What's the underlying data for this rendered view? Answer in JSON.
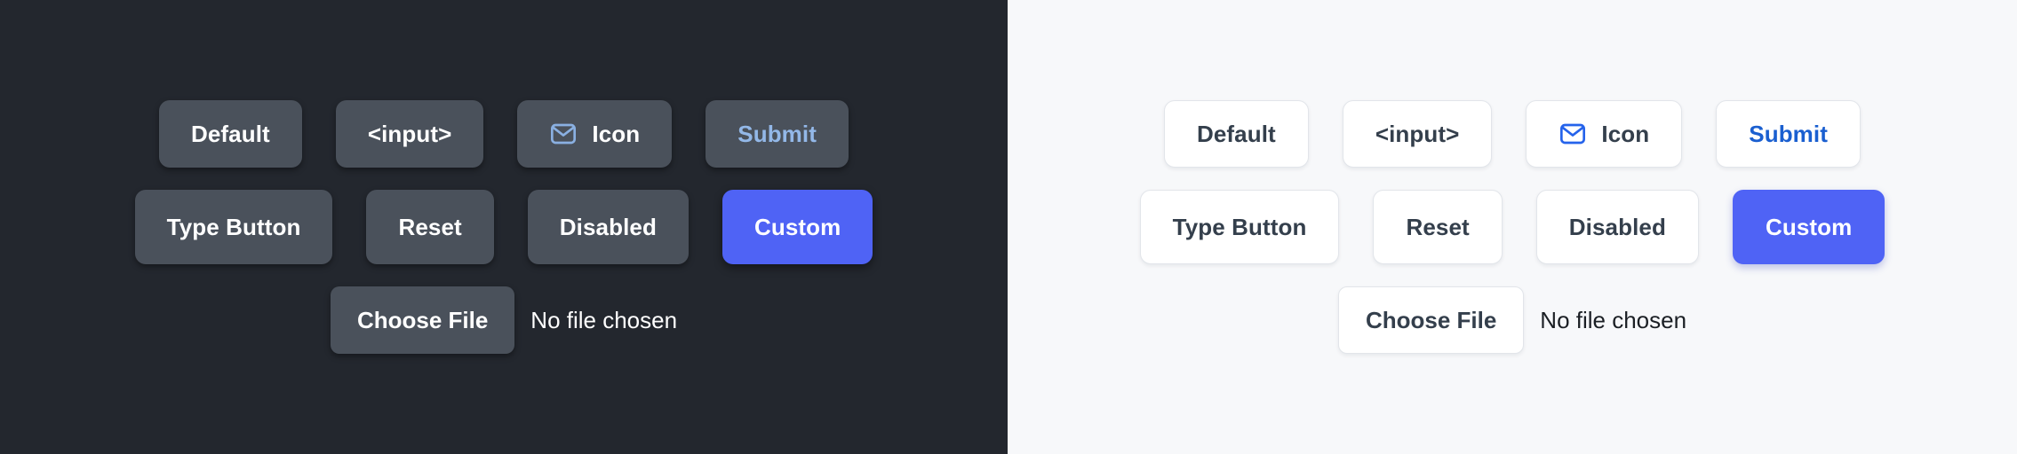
{
  "panels": [
    {
      "theme": "dark",
      "background": "#23272e",
      "surface": "#4a515b",
      "text": "#ffffff",
      "accent": "#4f63f5",
      "link_text": "#93b8e8",
      "icon_color": "#8ab0e2",
      "rows": [
        [
          {
            "name": "default-button",
            "label": "Default",
            "variant": "plain",
            "icon": null
          },
          {
            "name": "input-button",
            "label": "<input>",
            "variant": "plain",
            "icon": null
          },
          {
            "name": "icon-button",
            "label": "Icon",
            "variant": "plain",
            "icon": "envelope-icon"
          },
          {
            "name": "submit-button",
            "label": "Submit",
            "variant": "submit",
            "icon": null
          }
        ],
        [
          {
            "name": "type-button",
            "label": "Type Button",
            "variant": "plain",
            "icon": null
          },
          {
            "name": "reset-button",
            "label": "Reset",
            "variant": "plain",
            "icon": null
          },
          {
            "name": "disabled-button",
            "label": "Disabled",
            "variant": "plain",
            "icon": null
          },
          {
            "name": "custom-button",
            "label": "Custom",
            "variant": "custom",
            "icon": null
          }
        ]
      ],
      "file_input": {
        "button_label": "Choose File",
        "status_text": "No file chosen"
      }
    },
    {
      "theme": "light",
      "background": "#f7f8fa",
      "surface": "#ffffff",
      "text": "#343f4c",
      "accent": "#4f63f5",
      "link_text": "#1a5fd0",
      "icon_color": "#2563eb",
      "rows": [
        [
          {
            "name": "default-button",
            "label": "Default",
            "variant": "plain",
            "icon": null
          },
          {
            "name": "input-button",
            "label": "<input>",
            "variant": "plain",
            "icon": null
          },
          {
            "name": "icon-button",
            "label": "Icon",
            "variant": "plain",
            "icon": "envelope-icon"
          },
          {
            "name": "submit-button",
            "label": "Submit",
            "variant": "submit",
            "icon": null
          }
        ],
        [
          {
            "name": "type-button",
            "label": "Type Button",
            "variant": "plain",
            "icon": null
          },
          {
            "name": "reset-button",
            "label": "Reset",
            "variant": "plain",
            "icon": null
          },
          {
            "name": "disabled-button",
            "label": "Disabled",
            "variant": "plain",
            "icon": null
          },
          {
            "name": "custom-button",
            "label": "Custom",
            "variant": "custom",
            "icon": null
          }
        ]
      ],
      "file_input": {
        "button_label": "Choose File",
        "status_text": "No file chosen"
      }
    }
  ]
}
